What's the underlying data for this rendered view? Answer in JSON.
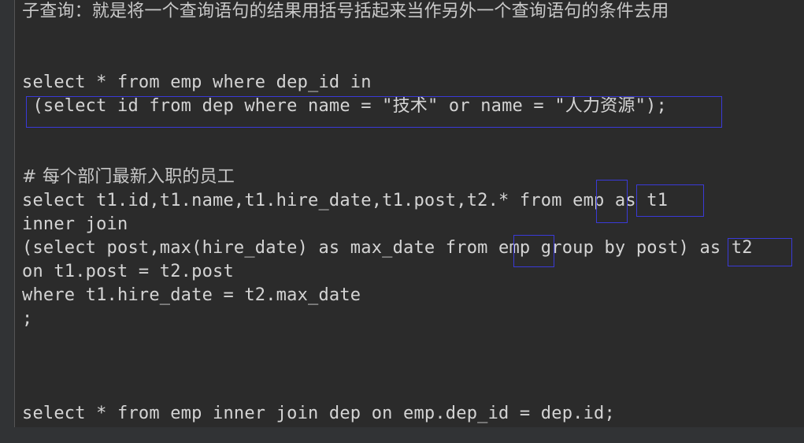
{
  "editor": {
    "lines": [
      "子查询：就是将一个查询语句的结果用括号括起来当作另外一个查询语句的条件去用",
      "select * from emp where dep_id in",
      " (select id from dep where name = \"技术\" or name = \"人力资源\");",
      "# 每个部门最新入职的员工",
      "select t1.id,t1.name,t1.hire_date,t1.post,t2.* from emp as t1",
      "inner join",
      "(select post,max(hire_date) as max_date from emp group by post) as t2",
      "on t1.post = t2.post",
      "where t1.hire_date = t2.max_date",
      ";",
      "select * from emp inner join dep on emp.dep_id = dep.id;"
    ]
  }
}
